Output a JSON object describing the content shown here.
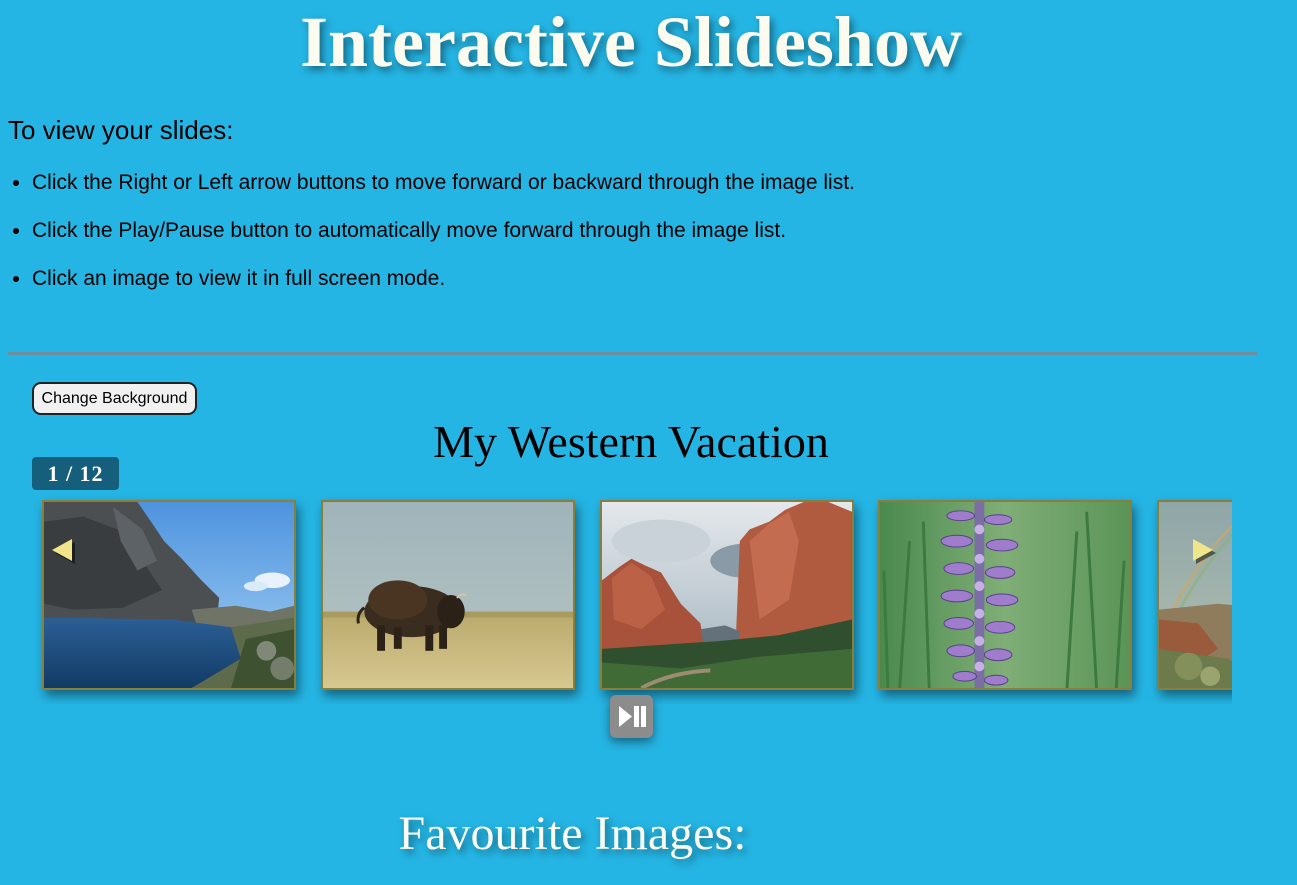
{
  "page": {
    "title": "Interactive Slideshow",
    "background_color": "#25b5e4"
  },
  "instructions": {
    "heading": "To view your slides:",
    "items": [
      "Click the Right or Left arrow buttons to move forward or backward through the image list.",
      "Click the Play/Pause button to automatically move forward through the image list.",
      "Click an image to view it in full screen mode."
    ]
  },
  "controls": {
    "change_background_label": "Change Background"
  },
  "slideshow": {
    "album_title": "My Western Vacation",
    "counter": "1 / 12",
    "current_index": 1,
    "total": 12,
    "visible_slides": [
      {
        "subject": "mountain-lake"
      },
      {
        "subject": "bison"
      },
      {
        "subject": "red-rock-formations"
      },
      {
        "subject": "purple-wildflower"
      },
      {
        "subject": "canyon-rainbow"
      }
    ],
    "icons": {
      "previous": "arrow-left-icon",
      "next": "arrow-right-icon",
      "play_pause": "play-pause-icon"
    },
    "arrow_color": "#f1e58c",
    "counter_color": "#165f7c"
  },
  "favourites": {
    "heading": "Favourite Images:"
  }
}
